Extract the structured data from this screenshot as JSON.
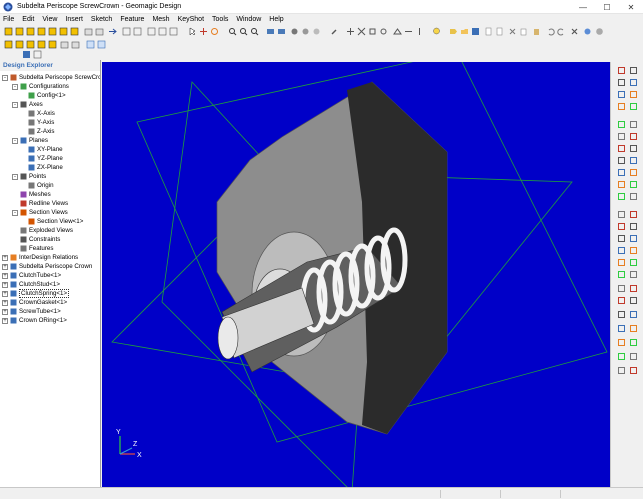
{
  "window": {
    "title": "Subdelta Periscope ScrewCrown - Geomagic Design",
    "minimize": "—",
    "maximize": "☐",
    "close": "✕"
  },
  "menu": [
    "File",
    "Edit",
    "View",
    "Insert",
    "Sketch",
    "Feature",
    "Mesh",
    "KeyShot",
    "Tools",
    "Window",
    "Help"
  ],
  "explorer": {
    "header": "Design Explorer",
    "items": [
      {
        "label": "Subdelta Periscope ScrewCro",
        "icon": "assembly-icon"
      },
      {
        "label": "Configurations",
        "icon": "configurations-icon"
      },
      {
        "label": "Config<1>",
        "icon": "config-icon"
      },
      {
        "label": "Axes",
        "icon": "axes-icon"
      },
      {
        "label": "X-Axis",
        "icon": "axis-icon"
      },
      {
        "label": "Y-Axis",
        "icon": "axis-icon"
      },
      {
        "label": "Z-Axis",
        "icon": "axis-icon"
      },
      {
        "label": "Planes",
        "icon": "planes-icon"
      },
      {
        "label": "XY-Plane",
        "icon": "plane-icon"
      },
      {
        "label": "YZ-Plane",
        "icon": "plane-icon"
      },
      {
        "label": "ZX-Plane",
        "icon": "plane-icon"
      },
      {
        "label": "Points",
        "icon": "points-icon"
      },
      {
        "label": "Origin",
        "icon": "origin-icon"
      },
      {
        "label": "Meshes",
        "icon": "meshes-icon"
      },
      {
        "label": "Redline Views",
        "icon": "redline-icon"
      },
      {
        "label": "Section Views",
        "icon": "section-views-icon"
      },
      {
        "label": "Section View<1>",
        "icon": "section-view-icon"
      },
      {
        "label": "Exploded Views",
        "icon": "exploded-views-icon"
      },
      {
        "label": "Constraints",
        "icon": "constraints-icon"
      },
      {
        "label": "Features",
        "icon": "features-icon"
      },
      {
        "label": "InterDesign Relations",
        "icon": "relations-icon"
      },
      {
        "label": "Subdelta Periscope Crown",
        "icon": "part-icon"
      },
      {
        "label": "ClutchTube<1>",
        "icon": "part-icon"
      },
      {
        "label": "ClutchStud<1>",
        "icon": "part-icon"
      },
      {
        "label": "ClutchSpring<1>",
        "icon": "part-icon"
      },
      {
        "label": "CrownGasket<1>",
        "icon": "part-icon"
      },
      {
        "label": "ScrewTube<1>",
        "icon": "part-icon"
      },
      {
        "label": "Crown ORing<1>",
        "icon": "part-icon"
      }
    ]
  },
  "triad": {
    "x": "X",
    "y": "Y",
    "z": "Z"
  },
  "colors": {
    "viewport": "#0000c8",
    "plane_edges": "#1e9e3c",
    "accent": "#3b6fb6"
  }
}
